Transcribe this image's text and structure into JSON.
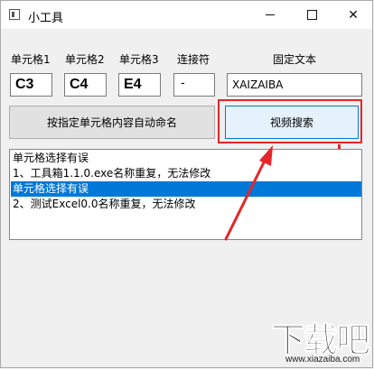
{
  "window": {
    "title": "小工具"
  },
  "titlebar_buttons": {
    "minimize": "minimize-icon",
    "maximize": "maximize-icon",
    "close": "close-icon",
    "close_glyph": "✕"
  },
  "labels": {
    "cell1": "单元格1",
    "cell2": "单元格2",
    "cell3": "单元格3",
    "connector": "连接符",
    "fixed_text": "固定文本"
  },
  "inputs": {
    "cell1": "C3",
    "cell2": "C4",
    "cell3": "E4",
    "connector": "-",
    "fixed_text": "XAIZAIBA"
  },
  "buttons": {
    "auto_name": "按指定单元格内容自动命名",
    "video_search": "视频搜索"
  },
  "log_list": {
    "items": [
      "单元格选择有误",
      "1、工具箱1.1.0.exe名称重复，无法修改",
      "单元格选择有误",
      "2、测试Excel0.0名称重复，无法修改"
    ],
    "selected_index": 2
  },
  "annotation": {
    "color": "#e4262b"
  },
  "watermark": {
    "main": "下载吧",
    "url": "www.xiazaiba.com"
  }
}
